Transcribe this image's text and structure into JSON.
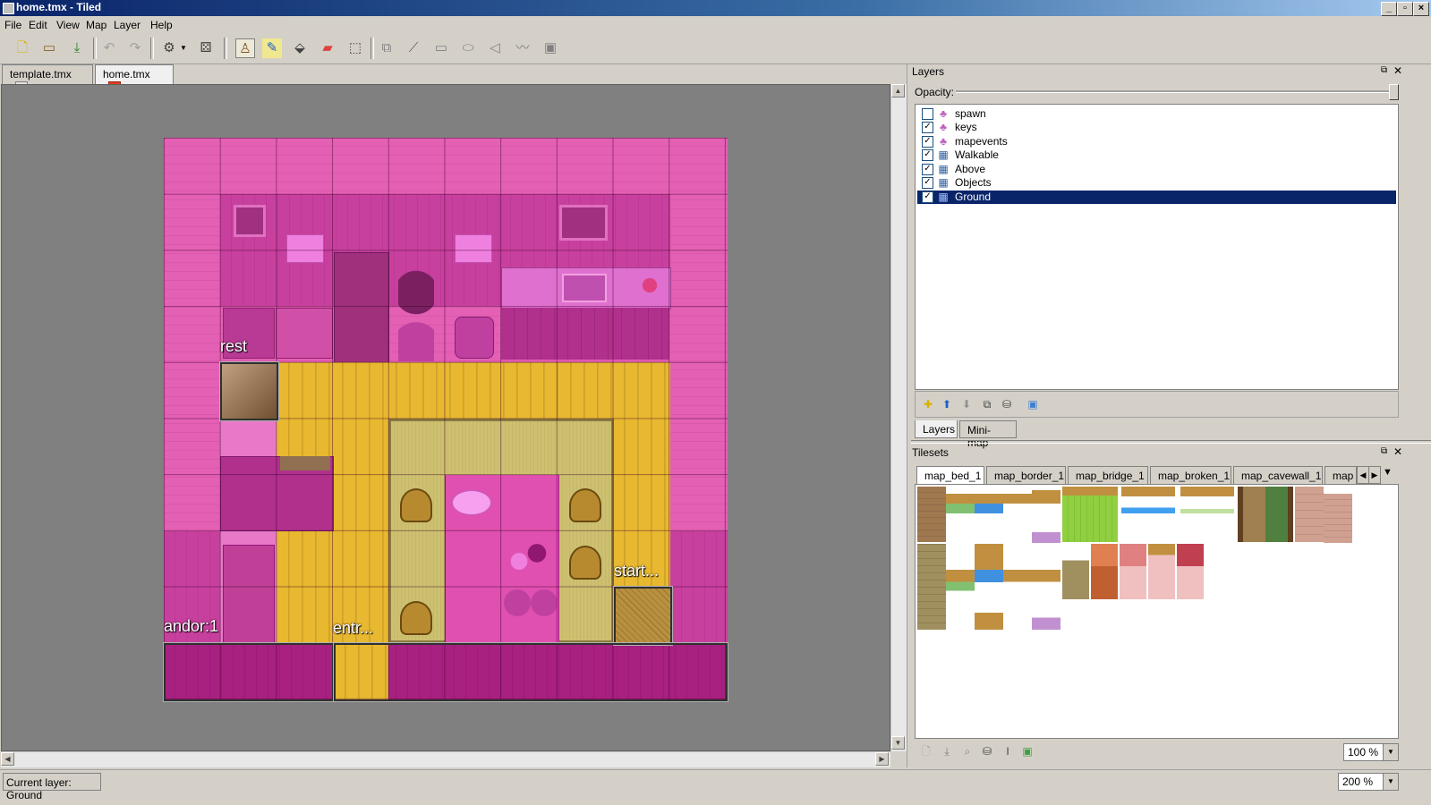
{
  "window": {
    "title": "home.tmx - Tiled"
  },
  "menu": [
    "File",
    "Edit",
    "View",
    "Map",
    "Layer",
    "Help"
  ],
  "toolbar": {
    "icons": [
      "new-file-icon",
      "open-folder-icon",
      "save-icon",
      "undo-icon",
      "redo-icon",
      "commands-icon",
      "random-dice-icon",
      "stamp-brush-icon",
      "terrain-brush-icon",
      "bucket-fill-icon",
      "eraser-icon",
      "rect-select-icon",
      "select-objects-icon",
      "edit-polygons-icon",
      "insert-rectangle-icon",
      "insert-ellipse-icon",
      "insert-polygon-icon",
      "insert-polyline-icon",
      "insert-tile-icon"
    ]
  },
  "tabs": [
    {
      "label": "template.tmx",
      "active": false
    },
    {
      "label": "home.tmx",
      "active": true
    }
  ],
  "map": {
    "objects": [
      {
        "label": "rest"
      },
      {
        "label": "start..."
      },
      {
        "label": "andor:1"
      },
      {
        "label": "entr..."
      }
    ]
  },
  "layers_panel": {
    "title": "Layers",
    "opacity_label": "Opacity:",
    "layers": [
      {
        "name": "spawn",
        "type": "object",
        "visible": false,
        "selected": false
      },
      {
        "name": "keys",
        "type": "object",
        "visible": true,
        "selected": false
      },
      {
        "name": "mapevents",
        "type": "object",
        "visible": true,
        "selected": false
      },
      {
        "name": "Walkable",
        "type": "tile",
        "visible": true,
        "selected": false
      },
      {
        "name": "Above",
        "type": "tile",
        "visible": true,
        "selected": false
      },
      {
        "name": "Objects",
        "type": "tile",
        "visible": true,
        "selected": false
      },
      {
        "name": "Ground",
        "type": "tile",
        "visible": true,
        "selected": true
      }
    ],
    "bottom_tabs": [
      {
        "label": "Layers",
        "active": true
      },
      {
        "label": "Mini-map",
        "active": false
      }
    ]
  },
  "tilesets_panel": {
    "title": "Tilesets",
    "tabs": [
      "map_bed_1",
      "map_border_1",
      "map_bridge_1",
      "map_broken_1",
      "map_cavewall_1",
      "map"
    ],
    "zoom": "100 %"
  },
  "status": {
    "current_layer": "Current layer: Ground",
    "zoom": "200 %"
  },
  "colors": {
    "selection": "#0a246a",
    "map_bg": "#808080",
    "pink_wall": "#c8409e",
    "yellow_floor": "#e8b830"
  }
}
